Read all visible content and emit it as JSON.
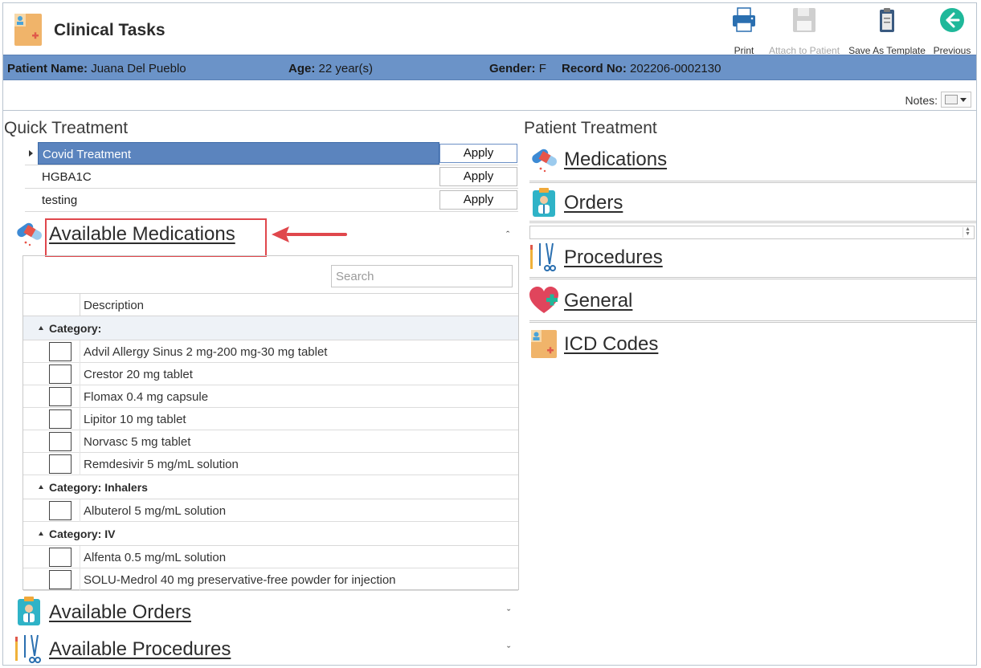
{
  "app": {
    "title": "Clinical Tasks"
  },
  "toolbar": {
    "print": "Print",
    "attach": "Attach to Patient",
    "save_template": "Save As Template",
    "previous": "Previous"
  },
  "patient": {
    "name_label": "Patient Name:",
    "name": "Juana Del Pueblo",
    "age_label": "Age:",
    "age": "22 year(s)",
    "gender_label": "Gender:",
    "gender": "F",
    "record_label": "Record No:",
    "record": "202206-0002130"
  },
  "notes": {
    "label": "Notes:"
  },
  "quick_treatment": {
    "title": "Quick Treatment",
    "apply_label": "Apply",
    "rows": [
      {
        "name": "Covid Treatment",
        "selected": true
      },
      {
        "name": "HGBA1C",
        "selected": false
      },
      {
        "name": "testing",
        "selected": false
      }
    ]
  },
  "available": {
    "medications_title": "Available Medications",
    "orders_title": "Available Orders",
    "procedures_title": "Available Procedures",
    "search_placeholder": "Search",
    "description_header": "Description",
    "categories": [
      {
        "label": "Category:",
        "items": [
          "Advil Allergy Sinus 2 mg-200 mg-30 mg tablet",
          "Crestor 20 mg tablet",
          "Flomax 0.4 mg capsule",
          "Lipitor 10 mg tablet",
          "Norvasc 5 mg tablet",
          "Remdesivir 5 mg/mL solution"
        ]
      },
      {
        "label": "Category: Inhalers",
        "items": [
          "Albuterol 5 mg/mL solution"
        ]
      },
      {
        "label": "Category: IV",
        "items": [
          "Alfenta 0.5 mg/mL solution",
          "SOLU-Medrol 40 mg preservative-free powder for injection"
        ]
      }
    ]
  },
  "patient_treatment": {
    "title": "Patient Treatment",
    "medications": "Medications",
    "orders": "Orders",
    "procedures": "Procedures",
    "general": "General",
    "icd_codes": "ICD Codes"
  },
  "colors": {
    "patient_bar": "#6b93c8",
    "selection": "#5b84be",
    "highlight": "#e0474c"
  }
}
